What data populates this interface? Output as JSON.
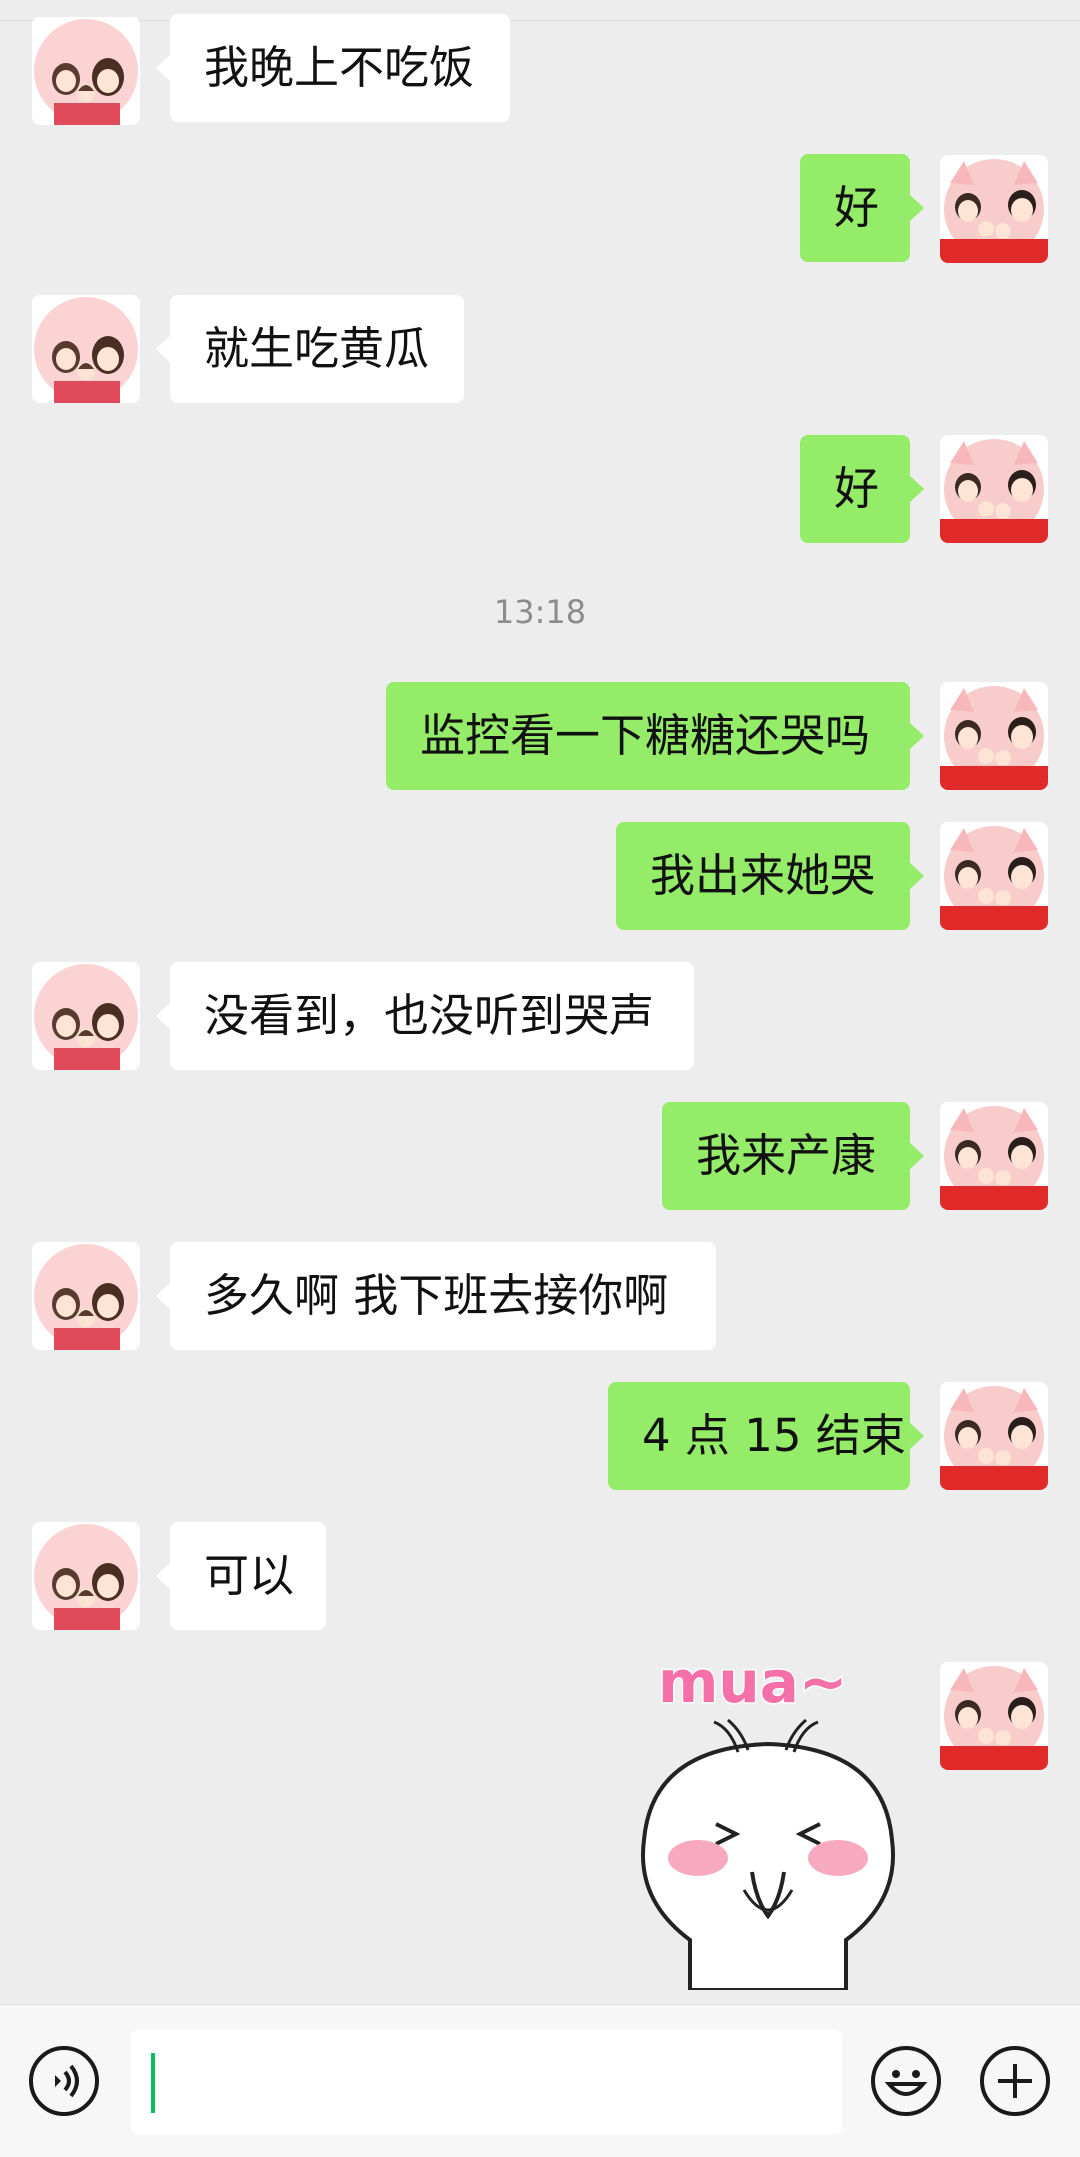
{
  "conversation": {
    "timestamp": "13:18",
    "messages": [
      {
        "side": "in",
        "text": "我晚上不吃饭"
      },
      {
        "side": "out",
        "text": "好"
      },
      {
        "side": "in",
        "text": "就生吃黄瓜"
      },
      {
        "side": "out",
        "text": "好"
      },
      {
        "side": "out",
        "text": "监控看一下糖糖还哭吗"
      },
      {
        "side": "out",
        "text": "我出来她哭"
      },
      {
        "side": "in",
        "text": "没看到，也没听到哭声"
      },
      {
        "side": "out",
        "text": "我来产康"
      },
      {
        "side": "in",
        "text": "多久啊  我下班去接你啊"
      },
      {
        "side": "out",
        "text": "4 点 15 结束"
      },
      {
        "side": "in",
        "text": "可以"
      }
    ],
    "sticker": {
      "text": "mua~",
      "icon": "cute-blob-sticker"
    }
  },
  "input_bar": {
    "voice_icon": "voice-icon",
    "input_value": "",
    "emoji_icon": "emoji-icon",
    "more_icon": "plus-icon"
  },
  "colors": {
    "background": "#ededed",
    "outgoing_bubble": "#95ec69",
    "incoming_bubble": "#ffffff",
    "caret": "#07c160"
  }
}
